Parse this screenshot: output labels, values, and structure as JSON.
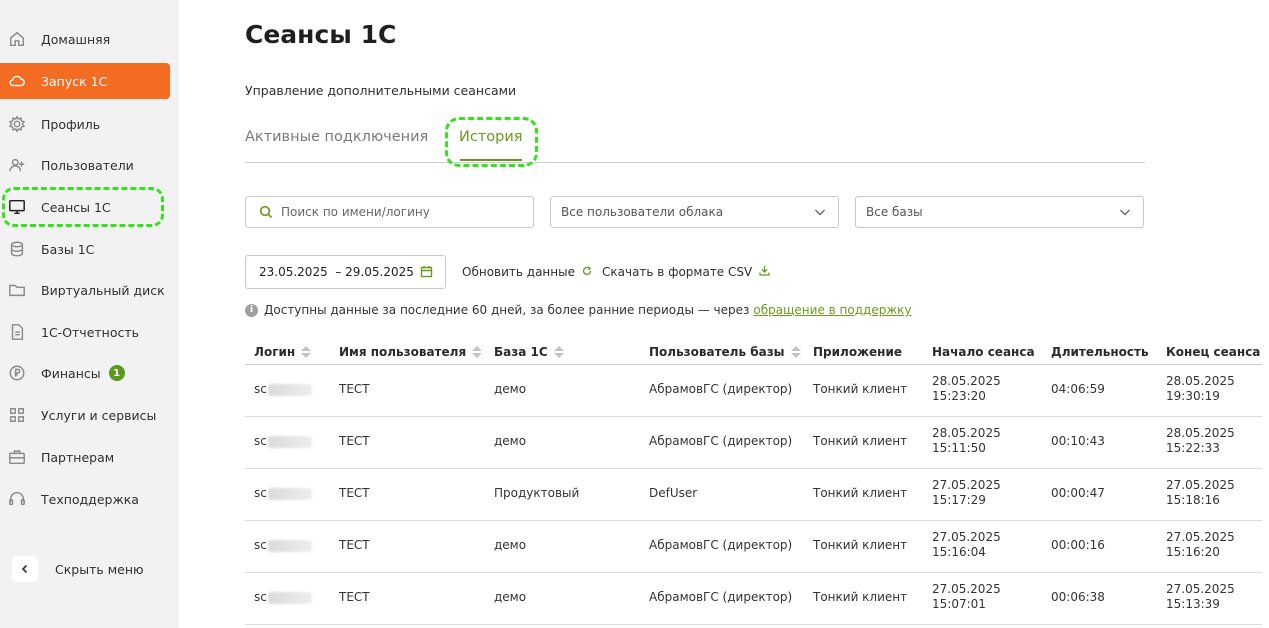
{
  "sidebar": {
    "items": [
      {
        "label": "Домашняя",
        "icon": "home-icon"
      },
      {
        "label": "Запуск 1С",
        "icon": "cloud-icon"
      },
      {
        "label": "Профиль",
        "icon": "gear-icon"
      },
      {
        "label": "Пользователи",
        "icon": "add-user-icon"
      },
      {
        "label": "Сеансы 1С",
        "icon": "monitor-icon"
      },
      {
        "label": "Базы 1С",
        "icon": "database-icon"
      },
      {
        "label": "Виртуальный диск",
        "icon": "folder-icon"
      },
      {
        "label": "1С-Отчетность",
        "icon": "document-icon"
      },
      {
        "label": "Финансы",
        "icon": "ruble-icon",
        "badge": "1"
      },
      {
        "label": "Услуги и сервисы",
        "icon": "grid-icon"
      },
      {
        "label": "Партнерам",
        "icon": "briefcase-icon"
      },
      {
        "label": "Техподдержка",
        "icon": "headset-icon"
      }
    ],
    "collapse_label": "Скрыть меню"
  },
  "page": {
    "title": "Сеансы 1С",
    "subtitle": "Управление дополнительными сеансами"
  },
  "tabs": [
    {
      "label": "Активные подключения",
      "active": false
    },
    {
      "label": "История",
      "active": true
    }
  ],
  "filters": {
    "search_placeholder": "Поиск по имени/логину",
    "users_select": "Все пользователи облака",
    "bases_select": "Все базы",
    "date_range": "23.05.2025  – 29.05.2025",
    "refresh_label": "Обновить данные",
    "download_label": "Скачать в формате CSV"
  },
  "info": {
    "text": "Доступны данные за последние 60 дней, за более ранние периоды — через",
    "link": "обращение в поддержку"
  },
  "table": {
    "headers": [
      "Логин",
      "Имя пользователя",
      "База 1С",
      "Пользователь базы",
      "Приложение",
      "Начало сеанса",
      "Длительность",
      "Конец сеанса"
    ],
    "rows": [
      {
        "login": "sc",
        "user": "ТЕСТ",
        "base": "демо",
        "base_user": "АбрамовГС (директор)",
        "app": "Тонкий клиент",
        "start_date": "28.05.2025",
        "start_time": "15:23:20",
        "duration": "04:06:59",
        "end_date": "28.05.2025",
        "end_time": "19:30:19"
      },
      {
        "login": "sc",
        "user": "ТЕСТ",
        "base": "демо",
        "base_user": "АбрамовГС (директор)",
        "app": "Тонкий клиент",
        "start_date": "28.05.2025",
        "start_time": "15:11:50",
        "duration": "00:10:43",
        "end_date": "28.05.2025",
        "end_time": "15:22:33"
      },
      {
        "login": "sc",
        "user": "ТЕСТ",
        "base": "Продуктовый",
        "base_user": "DefUser",
        "app": "Тонкий клиент",
        "start_date": "27.05.2025",
        "start_time": "15:17:29",
        "duration": "00:00:47",
        "end_date": "27.05.2025",
        "end_time": "15:18:16"
      },
      {
        "login": "sc",
        "user": "ТЕСТ",
        "base": "демо",
        "base_user": "АбрамовГС (директор)",
        "app": "Тонкий клиент",
        "start_date": "27.05.2025",
        "start_time": "15:16:04",
        "duration": "00:00:16",
        "end_date": "27.05.2025",
        "end_time": "15:16:20"
      },
      {
        "login": "sc",
        "user": "ТЕСТ",
        "base": "демо",
        "base_user": "АбрамовГС (директор)",
        "app": "Тонкий клиент",
        "start_date": "27.05.2025",
        "start_time": "15:07:01",
        "duration": "00:06:38",
        "end_date": "27.05.2025",
        "end_time": "15:13:39"
      }
    ]
  },
  "colors": {
    "accent_orange": "#f36c21",
    "accent_green": "#6a9a1e",
    "highlight": "#35e21c"
  }
}
